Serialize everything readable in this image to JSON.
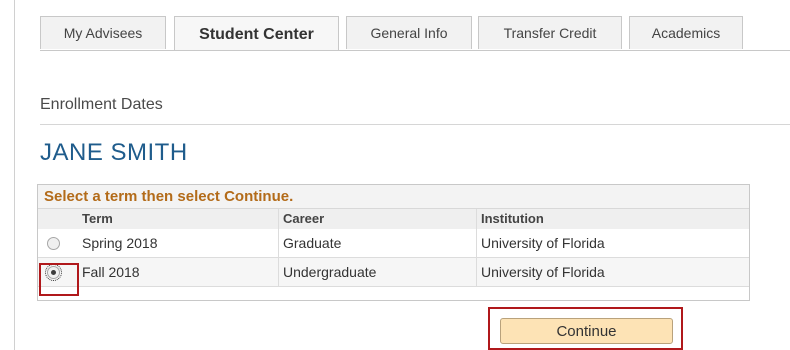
{
  "tabs": [
    {
      "label": "My Advisees",
      "active": false
    },
    {
      "label": "Student Center",
      "active": true
    },
    {
      "label": "General Info",
      "active": false
    },
    {
      "label": "Transfer Credit",
      "active": false
    },
    {
      "label": "Academics",
      "active": false
    }
  ],
  "page": {
    "section_title": "Enrollment Dates",
    "student_name": "JANE SMITH"
  },
  "grid": {
    "caption": "Select a term then select Continue.",
    "columns": [
      "Term",
      "Career",
      "Institution"
    ],
    "rows": [
      {
        "term": "Spring 2018",
        "career": "Graduate",
        "institution": "University of Florida",
        "selected": false
      },
      {
        "term": "Fall 2018",
        "career": "Undergraduate",
        "institution": "University of Florida",
        "selected": true
      }
    ]
  },
  "actions": {
    "continue_label": "Continue"
  },
  "colors": {
    "caption": "#b36b19",
    "name": "#1f5c8c",
    "highlight": "#b0181b",
    "button_bg": "#fde3b5"
  }
}
